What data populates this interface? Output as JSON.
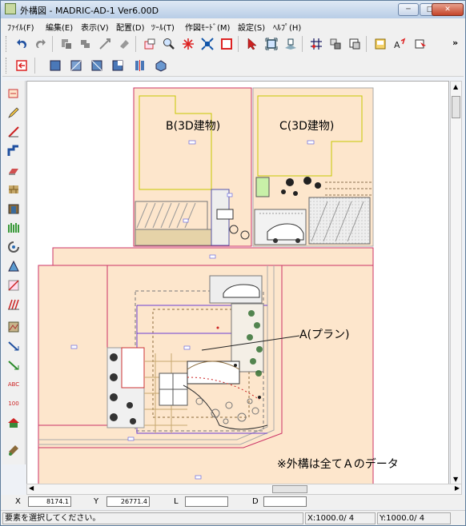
{
  "window": {
    "title": "外構図 - MADRIC-AD-1 Ver6.00D",
    "controls": {
      "minimize": "─",
      "maximize": "□",
      "close": "✕"
    }
  },
  "menu": [
    "ﾌｧｲﾙ(F)",
    "編集(E)",
    "表示(V)",
    "配置(D)",
    "ﾂｰﾙ(T)",
    "作図ﾓｰﾄﾞ(M)",
    "設定(S)",
    "ﾍﾙﾌﾟ(H)"
  ],
  "toolbar": {
    "overflow": "»",
    "abc": "ABC",
    "num": "100"
  },
  "drawing": {
    "label_b": "B(3D建物)",
    "label_c": "C(3D建物)",
    "label_a": "A(プラン)",
    "note": "※外構は全てＡのデータ"
  },
  "coords": {
    "x_label": "X",
    "x_value": "8174.1",
    "y_label": "Y",
    "y_value": "26771.4",
    "l_label": "L",
    "l_value": "",
    "d_label": "D",
    "d_value": ""
  },
  "status": {
    "message": "要素を選択してください。",
    "scale_x": "X:1000.0/ 4",
    "scale_y": "Y:1000.0/ 4"
  },
  "colors": {
    "lot_fill": "#fde6cc",
    "building_outline": "#c8c800",
    "boundary": "#cc3366",
    "selection": "#6a3fd4"
  }
}
